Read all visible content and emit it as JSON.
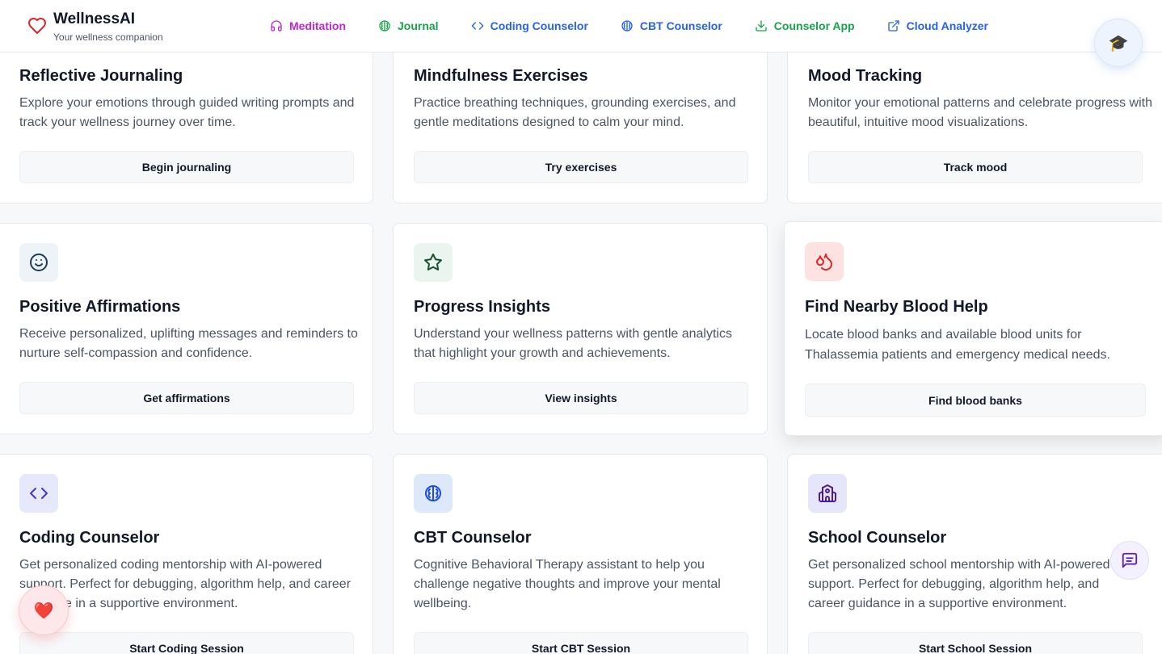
{
  "app": {
    "title": "WellnessAI",
    "subtitle": "Your wellness companion",
    "brand_icon": "heart-outline-icon",
    "accent": "#dc2626"
  },
  "nav": {
    "items": [
      {
        "label": "Meditation",
        "icon": "headphones-icon",
        "color": "#c026d3"
      },
      {
        "label": "Journal",
        "icon": "brain-icon",
        "color": "#16a34a"
      },
      {
        "label": "Coding Counselor",
        "icon": "code-icon",
        "color": "#2563eb"
      },
      {
        "label": "CBT Counselor",
        "icon": "brain-icon",
        "color": "#2563eb"
      },
      {
        "label": "Counselor App",
        "icon": "download-icon",
        "color": "#16a34a"
      },
      {
        "label": "Cloud Analyzer",
        "icon": "external-link-icon",
        "color": "#2563eb"
      }
    ]
  },
  "floating": {
    "graduation_icon": "🎓",
    "heart_icon": "❤️",
    "chat_icon": "message-square-icon"
  },
  "cards": [
    {
      "title": "Reflective Journaling",
      "desc": "Explore your emotions through guided writing prompts and track your wellness journey over time.",
      "button": "Begin journaling"
    },
    {
      "title": "Mindfulness Exercises",
      "desc": "Practice breathing techniques, grounding exercises, and gentle meditations designed to calm your mind.",
      "button": "Try exercises"
    },
    {
      "title": "Mood Tracking",
      "desc": "Monitor your emotional patterns and celebrate progress with beautiful, intuitive mood visualizations.",
      "button": "Track mood"
    },
    {
      "title": "Positive Affirmations",
      "desc": "Receive personalized, uplifting messages and reminders to nurture self-compassion and confidence.",
      "button": "Get affirmations",
      "icon": "smile-icon"
    },
    {
      "title": "Progress Insights",
      "desc": "Understand your wellness patterns with gentle analytics that highlight your growth and achievements.",
      "button": "View insights",
      "icon": "star-icon"
    },
    {
      "title": "Find Nearby Blood Help",
      "desc": "Locate blood banks and available blood units for Thalassemia patients and emergency medical needs.",
      "button": "Find blood banks",
      "icon": "droplets-icon"
    },
    {
      "title": "Coding Counselor",
      "desc": "Get personalized coding mentorship with AI-powered support. Perfect for debugging, algorithm help, and career guidance in a supportive environment.",
      "button": "Start Coding Session",
      "icon": "code-icon"
    },
    {
      "title": "CBT Counselor",
      "desc": "Cognitive Behavioral Therapy assistant to help you challenge negative thoughts and improve your mental wellbeing.",
      "button": "Start CBT Session",
      "icon": "brain-icon"
    },
    {
      "title": "School Counselor",
      "desc": "Get personalized school mentorship with AI-powered support. Perfect for debugging, algorithm help, and career guidance in a supportive environment.",
      "button": "Start School Session",
      "icon": "school-icon"
    }
  ]
}
